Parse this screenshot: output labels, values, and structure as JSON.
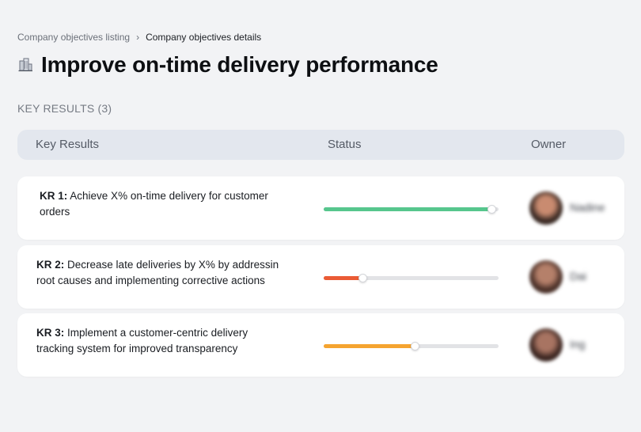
{
  "breadcrumb": {
    "parent": "Company objectives listing",
    "separator": "›",
    "current": "Company objectives details"
  },
  "page": {
    "icon": "office-building-icon",
    "title": "Improve on-time delivery performance"
  },
  "section": {
    "label": "KEY RESULTS (3)"
  },
  "table": {
    "headers": {
      "key_results": "Key Results",
      "status": "Status",
      "owner": "Owner"
    },
    "rows": [
      {
        "kr_label": "KR 1:",
        "text": "Achieve X% on-time delivery for customer orders",
        "progress": 0.96,
        "progress_color": "#56c68d",
        "owner": "Nadine",
        "avatar_colors": [
          "#3a2a24",
          "#c98b70"
        ]
      },
      {
        "kr_label": "KR 2:",
        "text": "Decrease late deliveries by X% by addressin root causes and implementing corrective actions",
        "progress": 0.22,
        "progress_color": "#ea5b35",
        "owner": "Dai",
        "avatar_colors": [
          "#4a3028",
          "#b5806a"
        ]
      },
      {
        "kr_label": "KR 3:",
        "text": "Implement a customer-centric delivery tracking system for improved transparency",
        "progress": 0.52,
        "progress_color": "#f5a430",
        "owner": "Ing",
        "avatar_colors": [
          "#3b2621",
          "#a87462"
        ]
      }
    ]
  }
}
